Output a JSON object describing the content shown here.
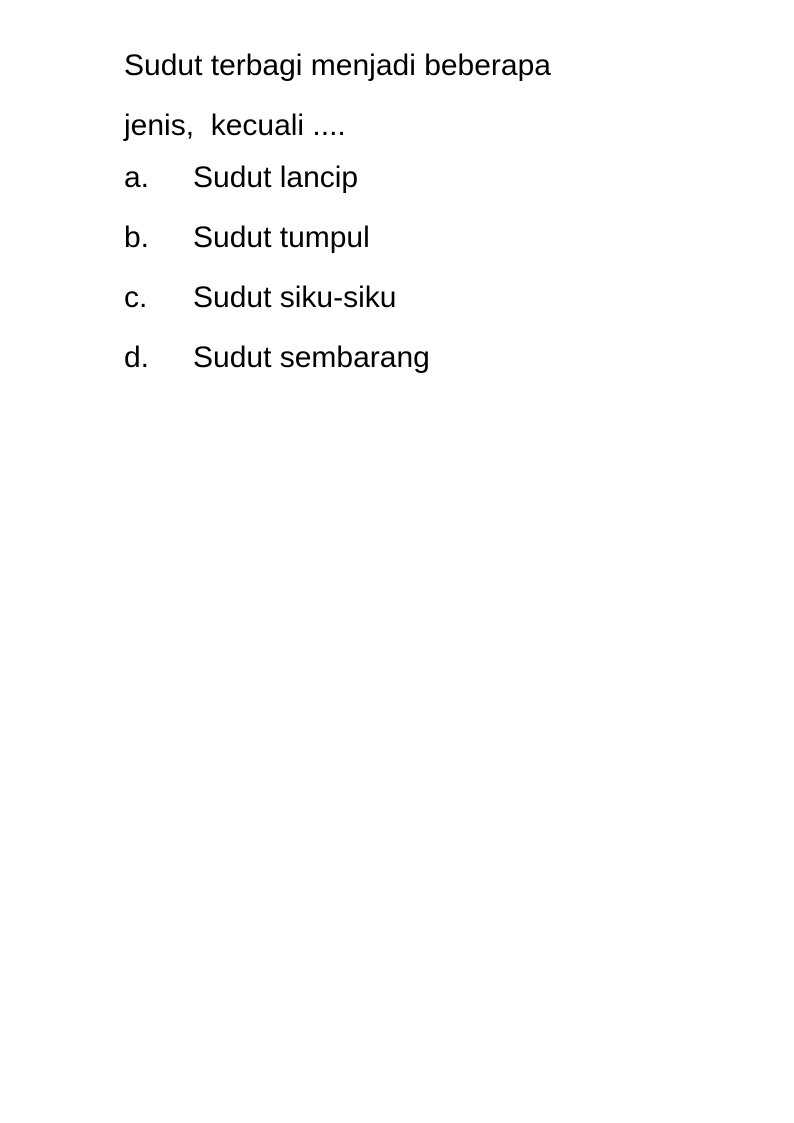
{
  "question": {
    "line1": "Sudut terbagi menjadi beberapa",
    "line2": "jenis,  kecuali ...."
  },
  "options": [
    {
      "letter": "a.",
      "text": "Sudut lancip"
    },
    {
      "letter": "b.",
      "text": "Sudut tumpul"
    },
    {
      "letter": "c.",
      "text": "Sudut siku-siku"
    },
    {
      "letter": "d.",
      "text": "Sudut sembarang"
    }
  ]
}
